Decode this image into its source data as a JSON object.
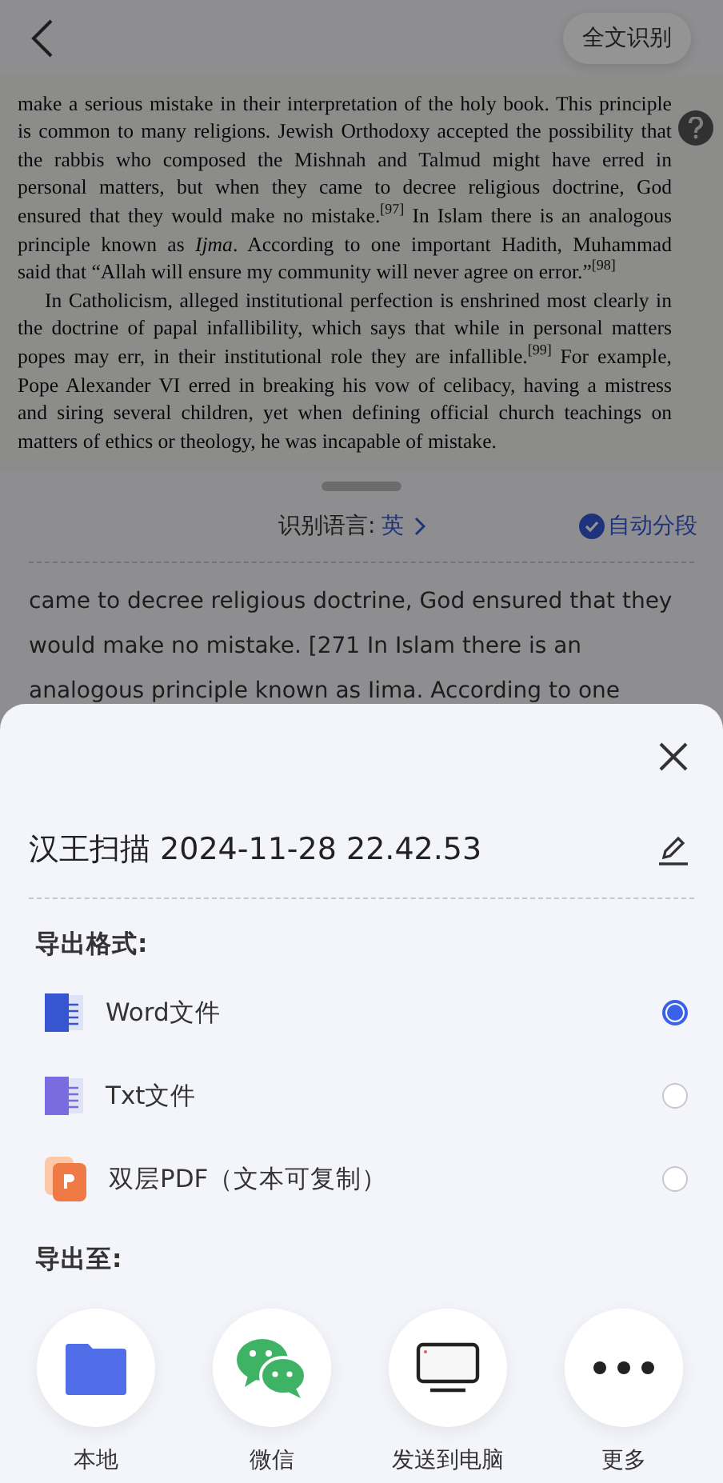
{
  "top_bar": {
    "action": "全文识别"
  },
  "scan": {
    "paragraphs": [
      {
        "indent": false,
        "lines": [
          "make a serious mistake in their interpretation of the holy book. This principle",
          "is common to many religions. Jewish Orthodoxy accepted the possibility that",
          "the rabbis who composed the Mishnah and Talmud might have erred in",
          "personal matters, but when they came to decree religious doctrine, God",
          "ensured that they would make no mistake.$^{[97]}$ In Islam there is an analogous",
          "principle known as *Ijma*. According to one important Hadith, Muhammad",
          "said that “Allah will ensure my community will never agree on error.”$^{[98]}$"
        ]
      },
      {
        "indent": true,
        "lines": [
          "In Catholicism, alleged institutional perfection is enshrined most clearly in",
          "the doctrine of papal infallibility, which says that while in personal matters",
          "popes may err, in their institutional role they are infallible.$^{[99]}$ For example,",
          "Pope Alexander VI erred in breaking his vow of celibacy, having a mistress",
          "and siring several children, yet when defining official church teachings on",
          "matters of ethics or theology, he was incapable of mistake."
        ]
      }
    ]
  },
  "language_row": {
    "label": "识别语言:",
    "value": "英",
    "auto_paragraph": {
      "label": "自动分段",
      "checked": true
    }
  },
  "ocr_lines": [
    "came to decree religious doctrine, God ensured that they",
    "would make no mistake. [271 In Islam there is an",
    "analogous principle known as Iima. According to one"
  ],
  "export_sheet": {
    "file_name": "汉王扫描 2024-11-28 22.42.53",
    "format_heading": "导出格式:",
    "formats": [
      {
        "kind": "word",
        "label": "Word文件",
        "selected": true
      },
      {
        "kind": "txt",
        "label": "Txt文件",
        "selected": false
      },
      {
        "kind": "pdf",
        "label": "双层PDF（文本可复制）",
        "selected": false
      }
    ],
    "destination_heading": "导出至:",
    "destinations": [
      {
        "kind": "folder",
        "label": "本地"
      },
      {
        "kind": "chat",
        "label": "微信"
      },
      {
        "kind": "computer",
        "label": "发送到电脑"
      },
      {
        "kind": "more",
        "label": "更多"
      }
    ]
  }
}
